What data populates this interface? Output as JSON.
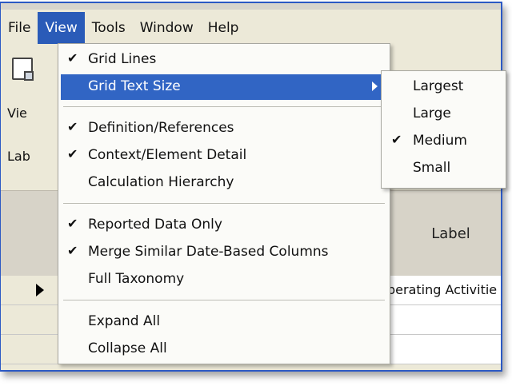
{
  "menubar": {
    "items": [
      {
        "label": "File"
      },
      {
        "label": "View"
      },
      {
        "label": "Tools"
      },
      {
        "label": "Window"
      },
      {
        "label": "Help"
      }
    ]
  },
  "background": {
    "label_view": "Vie",
    "label_lab": "Lab",
    "grid_column_label": "Label",
    "row1_cell": "perating Activitie"
  },
  "view_menu": {
    "grid_lines": {
      "label": "Grid Lines",
      "checked": true
    },
    "grid_text_size": {
      "label": "Grid Text Size"
    },
    "definition_references": {
      "label": "Definition/References",
      "checked": true
    },
    "context_element_detail": {
      "label": "Context/Element Detail",
      "checked": true
    },
    "calculation_hierarchy": {
      "label": "Calculation Hierarchy",
      "checked": false
    },
    "reported_data_only": {
      "label": "Reported Data Only",
      "checked": true
    },
    "merge_similar": {
      "label": "Merge Similar Date-Based Columns",
      "checked": true
    },
    "full_taxonomy": {
      "label": "Full Taxonomy",
      "checked": false
    },
    "expand_all": {
      "label": "Expand All"
    },
    "collapse_all": {
      "label": "Collapse All"
    }
  },
  "grid_text_size_submenu": {
    "largest": {
      "label": "Largest",
      "checked": false
    },
    "large": {
      "label": "Large",
      "checked": false
    },
    "medium": {
      "label": "Medium",
      "checked": true
    },
    "small": {
      "label": "Small",
      "checked": false
    }
  },
  "check_glyph": "✔",
  "colors": {
    "menu_highlight": "#3165c4",
    "window_border": "#2c59c4"
  }
}
